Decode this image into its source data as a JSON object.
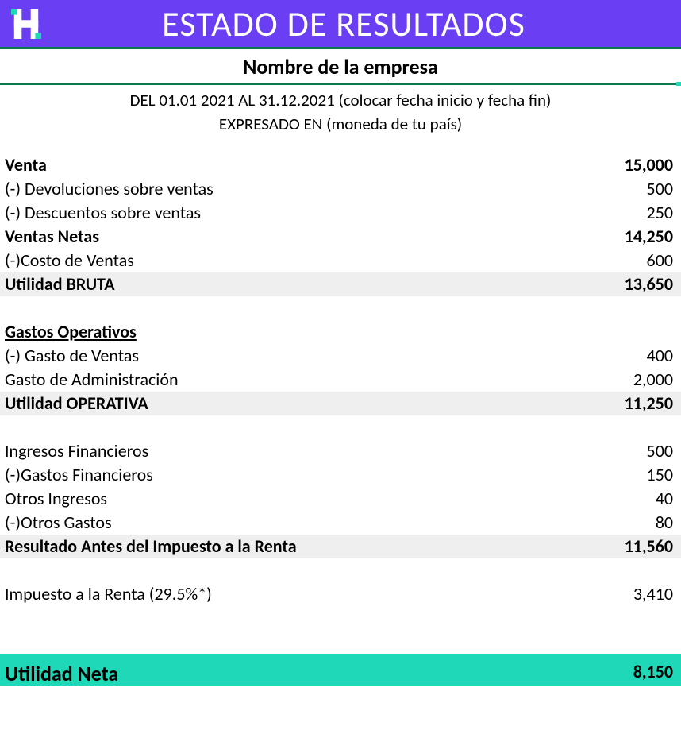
{
  "header": {
    "title": "ESTADO DE RESULTADOS"
  },
  "company": "Nombre de la empresa",
  "period_line": "DEL 01.01 2021 AL 31.12.2021 (colocar fecha inicio y fecha fin)",
  "currency_line": "EXPRESADO EN (moneda de tu país)",
  "lines": {
    "venta": {
      "label": "Venta",
      "value": "15,000"
    },
    "devoluciones": {
      "label": "(-) Devoluciones sobre ventas",
      "value": "500"
    },
    "descuentos": {
      "label": "(-) Descuentos sobre ventas",
      "value": "250"
    },
    "ventas_netas": {
      "label": "Ventas Netas",
      "value": "14,250"
    },
    "costo_ventas": {
      "label": "(-)Costo de Ventas",
      "value": "600"
    },
    "utilidad_bruta": {
      "label": "Utilidad BRUTA",
      "value": "13,650"
    },
    "gastos_operativos": {
      "label": "Gastos Operativos"
    },
    "gasto_ventas": {
      "label": "(-) Gasto de Ventas",
      "value": "400"
    },
    "gasto_admin": {
      "label": "Gasto de Administración",
      "value": "2,000"
    },
    "utilidad_operativa": {
      "label": "Utilidad OPERATIVA",
      "value": "11,250"
    },
    "ingresos_fin": {
      "label": "Ingresos Financieros",
      "value": "500"
    },
    "gastos_fin": {
      "label": "(-)Gastos Financieros",
      "value": "150"
    },
    "otros_ingresos": {
      "label": "Otros Ingresos",
      "value": "40"
    },
    "otros_gastos": {
      "label": "(-)Otros Gastos",
      "value": "80"
    },
    "resultado_antes": {
      "label": "Resultado Antes del Impuesto a la Renta",
      "value": "11,560"
    },
    "impuesto": {
      "label": "Impuesto a la Renta (29.5%*)",
      "value": "3,410"
    },
    "utilidad_neta": {
      "label": "Utilidad Neta",
      "value": "8,150"
    }
  }
}
